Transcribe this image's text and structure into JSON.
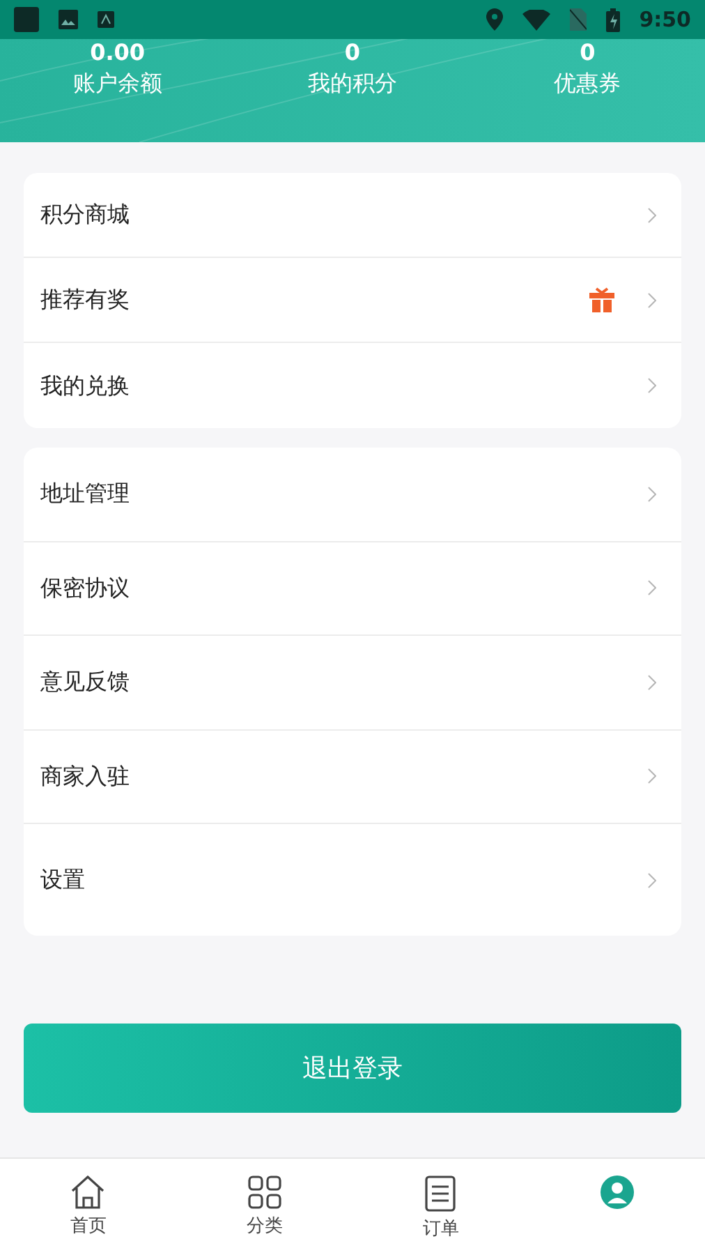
{
  "status_bar": {
    "time": "9:50"
  },
  "stats": [
    {
      "value": "0.00",
      "label": "账户余额"
    },
    {
      "value": "0",
      "label": "我的积分"
    },
    {
      "value": "0",
      "label": "优惠券"
    }
  ],
  "menu_groups": [
    {
      "items": [
        {
          "label": "积分商城",
          "gift": false
        },
        {
          "label": "推荐有奖",
          "gift": true
        },
        {
          "label": "我的兑换",
          "gift": false
        }
      ]
    },
    {
      "items": [
        {
          "label": "地址管理",
          "gift": false
        },
        {
          "label": "保密协议",
          "gift": false
        },
        {
          "label": "意见反馈",
          "gift": false
        },
        {
          "label": "商家入驻",
          "gift": false
        },
        {
          "label": "设置",
          "gift": false
        }
      ]
    }
  ],
  "logout_button": "退出登录",
  "tab_bar": [
    {
      "kind": "home",
      "label": "首页",
      "selected": false
    },
    {
      "kind": "category",
      "label": "分类",
      "selected": false
    },
    {
      "kind": "orders",
      "label": "订单",
      "selected": false
    },
    {
      "kind": "profile",
      "selected": true
    }
  ]
}
